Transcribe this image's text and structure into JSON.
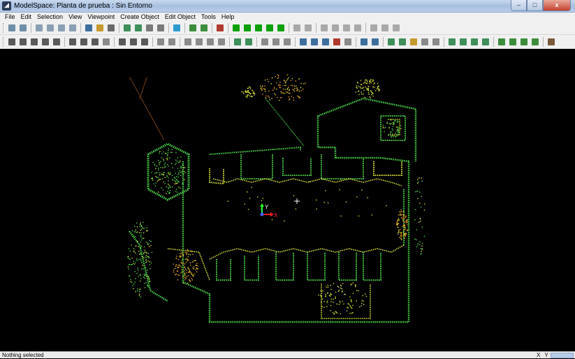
{
  "window": {
    "title": "ModelSpace: Planta de prueba : Sin Entorno",
    "controls": {
      "minimize": "–",
      "maximize": "□",
      "close": "x"
    }
  },
  "menu": [
    "File",
    "Edit",
    "Selection",
    "View",
    "Viewpoint",
    "Create Object",
    "Edit Object",
    "Tools",
    "Help"
  ],
  "toolbar1": {
    "buttons": [
      {
        "icon": "grid-snap-icon",
        "color": "#6f8fa8"
      },
      {
        "icon": "grid-points-icon",
        "color": "#6f8fa8"
      },
      "sep",
      {
        "icon": "cloud-points-icon",
        "color": "#8a9fb3"
      },
      {
        "icon": "cloud-filter-icon",
        "color": "#8a9fb3"
      },
      {
        "icon": "cloud-mesh-icon",
        "color": "#8a9fb3"
      },
      {
        "icon": "cloud-section-icon",
        "color": "#8a9fb3"
      },
      "sep",
      {
        "icon": "scan-world-icon",
        "color": "#3d6f9e"
      },
      {
        "icon": "model-space-icon",
        "color": "#c69a2e"
      },
      {
        "icon": "layers-icon",
        "color": "#6a6a6a"
      },
      "sep",
      {
        "icon": "registration-icon",
        "color": "#3e8f5a"
      },
      {
        "icon": "target-icon",
        "color": "#3e8f5a"
      },
      {
        "icon": "fence-icon",
        "color": "#7a7a7a"
      },
      {
        "icon": "fence-clear-icon",
        "color": "#7a7a7a"
      },
      "sep",
      {
        "icon": "limit-box-icon",
        "color": "#2f9acf"
      },
      "sep",
      {
        "icon": "table-view-icon",
        "color": "#3d8d3d"
      },
      {
        "icon": "cross-section-icon",
        "color": "#3d8d3d"
      },
      "sep",
      {
        "icon": "visibility-icon",
        "color": "#b03a2e"
      },
      "sep",
      {
        "icon": "layer-green-1-icon",
        "color": "#0aa00a"
      },
      {
        "icon": "layer-green-2-icon",
        "color": "#0aa00a"
      },
      {
        "icon": "layer-green-3-icon",
        "color": "#0aa00a"
      },
      {
        "icon": "layer-green-4-icon",
        "color": "#0aa00a"
      },
      {
        "icon": "layer-green-5-icon",
        "color": "#0aa00a"
      },
      "sep",
      {
        "icon": "undo-icon",
        "color": "#a9a9a9"
      },
      {
        "icon": "redo-icon",
        "color": "#a9a9a9"
      },
      "sep",
      {
        "icon": "cut-icon",
        "color": "#a9a9a9"
      },
      {
        "icon": "copy-icon",
        "color": "#a9a9a9"
      },
      {
        "icon": "paste-icon",
        "color": "#a9a9a9"
      },
      {
        "icon": "delete-icon",
        "color": "#a9a9a9"
      },
      "sep",
      {
        "icon": "constraint-icon",
        "color": "#a9a9a9"
      },
      {
        "icon": "constraint-edit-icon",
        "color": "#a9a9a9"
      },
      {
        "icon": "constraint-check-icon",
        "color": "#a9a9a9"
      }
    ]
  },
  "toolbar2": {
    "buttons": [
      {
        "icon": "select-arrow-icon",
        "color": "#5a5a5a"
      },
      {
        "icon": "select-add-icon",
        "color": "#5a5a5a"
      },
      {
        "icon": "pan-hand-icon",
        "color": "#5a5a5a"
      },
      {
        "icon": "pick-pencil-icon",
        "color": "#5a5a5a"
      },
      {
        "icon": "move-icon",
        "color": "#5a5a5a"
      },
      "sep",
      {
        "icon": "fence-polygon-icon",
        "color": "#5a5a5a"
      },
      {
        "icon": "fence-rectangle-icon",
        "color": "#5a5a5a"
      },
      {
        "icon": "fence-circle-icon",
        "color": "#5a5a5a"
      },
      {
        "icon": "fence-lasso-icon",
        "color": "#8a8a8a"
      },
      "sep",
      {
        "icon": "rotate-icon",
        "color": "#5a5a5a"
      },
      {
        "icon": "orbit-icon",
        "color": "#5a5a5a"
      },
      {
        "icon": "walk-icon",
        "color": "#5a5a5a"
      },
      "sep",
      {
        "icon": "view-seek-icon",
        "color": "#8a8a8a"
      },
      {
        "icon": "view-fit-icon",
        "color": "#8a8a8a"
      },
      "sep",
      {
        "icon": "zoom-in-icon",
        "color": "#8a8a8a"
      },
      {
        "icon": "zoom-out-icon",
        "color": "#8a8a8a"
      },
      {
        "icon": "zoom-box-icon",
        "color": "#8a8a8a"
      },
      {
        "icon": "zoom-extents-icon",
        "color": "#8a8a8a"
      },
      "sep",
      {
        "icon": "zoom-selected-icon",
        "color": "#3e8f5a"
      },
      {
        "icon": "zoom-previous-icon",
        "color": "#3e8f5a"
      },
      "sep",
      {
        "icon": "view-top-icon",
        "color": "#8a8a8a"
      },
      {
        "icon": "view-front-icon",
        "color": "#8a8a8a"
      },
      {
        "icon": "view-side-icon",
        "color": "#8a8a8a"
      },
      "sep",
      {
        "icon": "measure-point-icon",
        "color": "#3d6f9e"
      },
      {
        "icon": "measure-distance-icon",
        "color": "#3d6f9e"
      },
      {
        "icon": "measure-area-icon",
        "color": "#3d6f9e"
      },
      {
        "icon": "measure-pencil-icon",
        "color": "#b03a2e"
      },
      {
        "icon": "measure-clear-icon",
        "color": "#8a8a8a"
      },
      "sep",
      {
        "icon": "hide-region-icon",
        "color": "#3d6f9e"
      },
      {
        "icon": "show-region-icon",
        "color": "#3d6f9e"
      },
      "sep",
      {
        "icon": "fit-object-icon",
        "color": "#3e8f5a"
      },
      {
        "icon": "fit-edit-icon",
        "color": "#3e8f5a"
      },
      {
        "icon": "fit-cylinder-icon",
        "color": "#c69a2e"
      },
      {
        "icon": "fit-plane-icon",
        "color": "#8a8a8a"
      },
      {
        "icon": "fit-box-icon",
        "color": "#8a8a8a"
      },
      "sep",
      {
        "icon": "layer-set-1-icon",
        "color": "#3e8f5a"
      },
      {
        "icon": "layer-set-2-icon",
        "color": "#3e8f5a"
      },
      {
        "icon": "layer-set-3-icon",
        "color": "#3e8f5a"
      },
      {
        "icon": "layer-set-4-icon",
        "color": "#3e8f5a"
      },
      "sep",
      {
        "icon": "render-points-icon",
        "color": "#3d8d3d"
      },
      {
        "icon": "render-shaded-icon",
        "color": "#3d8d3d"
      },
      {
        "icon": "render-color-icon",
        "color": "#3d8d3d"
      },
      {
        "icon": "render-intensity-icon",
        "color": "#3d8d3d"
      },
      "sep",
      {
        "icon": "render-settings-icon",
        "color": "#7a5a3a"
      }
    ]
  },
  "viewport": {
    "background": "#000000",
    "axis_labels": {
      "y": "Y",
      "x": "X"
    },
    "colors": {
      "green": "#4fd64b",
      "yellow": "#d9e23a",
      "orange": "#e8a020",
      "red_axis": "#ff2020",
      "green_axis": "#20ff20",
      "blue_axis": "#4060ff"
    }
  },
  "status": {
    "text": "Nothing selected",
    "coords_label": "X Y Z"
  }
}
